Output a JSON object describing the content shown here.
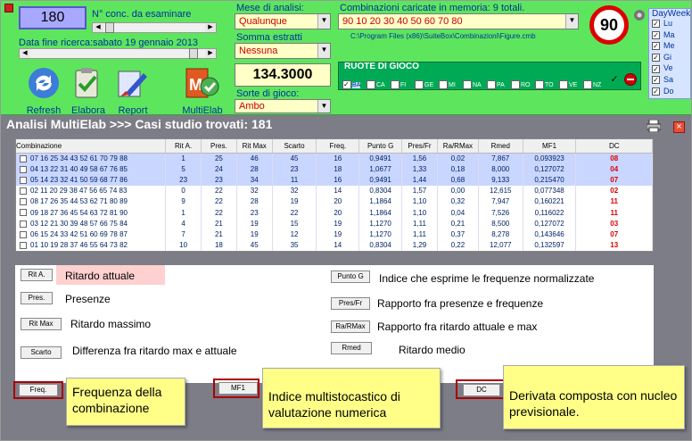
{
  "toolbar": {
    "count_value": "180",
    "count_label": "N° conc. da esaminare",
    "date_label": "Data fine ricerca:",
    "date_value": "sabato 19 gennaio 2013",
    "refresh": "Refresh",
    "elabora": "Elabora",
    "report": "Report",
    "multielab": "MultiElab",
    "mese_label": "Mese di analisi:",
    "mese_value": "Qualunque",
    "somma_label": "Somma estratti",
    "somma_value": "Nessuna",
    "number_value": "134.3000",
    "sorte_label": "Sorte di gioco:",
    "sorte_value": "Ambo",
    "combo_label": "Combinazioni caricate in memoria: 9 totali.",
    "combo_value": "90 10 20 30 40 50 60 70 80",
    "path": "C:\\Program Files (x86)\\SuiteBox\\Combinazioni\\Figure.cmb",
    "ruote_label": "RUOTE DI GIOCO",
    "ruote": [
      "BA",
      "CA",
      "FI",
      "GE",
      "MI",
      "NA",
      "PA",
      "RO",
      "TO",
      "VE",
      "NZ"
    ],
    "logo_90": "90",
    "dayweek_label": "DayWeek",
    "days": [
      "Lu",
      "Ma",
      "Me",
      "Gi",
      "Ve",
      "Sa",
      "Do"
    ]
  },
  "main": {
    "title": "Analisi MultiElab >>> Casi studio trovati: 181",
    "columns": [
      "Combinazione",
      "Rit A.",
      "Pres.",
      "Rit Max",
      "Scarto",
      "Freq.",
      "Punto G",
      "Pres/Fr",
      "Ra/RMax",
      "Rmed",
      "MF1",
      "DC"
    ],
    "rows": [
      [
        "07 16 25 34 43 52 61 70 79 88",
        "1",
        "25",
        "46",
        "45",
        "16",
        "0,9491",
        "1,56",
        "0,02",
        "7,867",
        "0,093923",
        "08"
      ],
      [
        "04 13 22 31 40 49 58 67 76 85",
        "5",
        "24",
        "28",
        "23",
        "18",
        "1,0677",
        "1,33",
        "0,18",
        "8,000",
        "0,127072",
        "04"
      ],
      [
        "05 14 23 32 41 50 59 68 77 86",
        "23",
        "23",
        "34",
        "11",
        "16",
        "0,9491",
        "1,44",
        "0,68",
        "9,133",
        "0,215470",
        "07"
      ],
      [
        "02 11 20 29 38 47 56 65 74 83",
        "0",
        "22",
        "32",
        "32",
        "14",
        "0,8304",
        "1,57",
        "0,00",
        "12,615",
        "0,077348",
        "02"
      ],
      [
        "08 17 26 35 44 53 62 71 80 89",
        "9",
        "22",
        "28",
        "19",
        "20",
        "1,1864",
        "1,10",
        "0,32",
        "7,947",
        "0,160221",
        "11"
      ],
      [
        "09 18 27 36 45 54 63 72 81 90",
        "1",
        "22",
        "23",
        "22",
        "20",
        "1,1864",
        "1,10",
        "0,04",
        "7,526",
        "0,116022",
        "11"
      ],
      [
        "03 12 21 30 39 48 57 66 75 84",
        "4",
        "21",
        "19",
        "15",
        "19",
        "1,1270",
        "1,11",
        "0,21",
        "8,500",
        "0,127072",
        "03"
      ],
      [
        "06 15 24 33 42 51 60 69 78 87",
        "7",
        "21",
        "19",
        "12",
        "19",
        "1,1270",
        "1,11",
        "0,37",
        "8,278",
        "0,143646",
        "07"
      ],
      [
        "01 10 19 28 37 46 55 64 73 82",
        "10",
        "18",
        "45",
        "35",
        "14",
        "0,8304",
        "1,29",
        "0,22",
        "12,077",
        "0,132597",
        "13"
      ]
    ]
  },
  "legend": {
    "rita_btn": "Rit A.",
    "rita_txt": "Ritardo attuale",
    "pres_btn": "Pres.",
    "pres_txt": "Presenze",
    "ritmax_btn": "Rit Max",
    "ritmax_txt": "Ritardo massimo",
    "scarto_btn": "Scarto",
    "scarto_txt": "Differenza fra ritardo max e attuale",
    "puntog_btn": "Punto G",
    "puntog_txt": "Indice che esprime le frequenze normalizzate",
    "presfr_btn": "Pres/Fr",
    "presfr_txt": "Rapporto fra presenze e frequenze",
    "rarmax_btn": "Ra/RMax",
    "rarmax_txt": "Rapporto fra ritardo attuale e max",
    "rmed_btn": "Rmed",
    "rmed_txt": "Ritardo medio"
  },
  "bottom": {
    "freq_btn": "Freq.",
    "freq_txt": "Frequenza della combinazione",
    "mf1_btn": "MF1",
    "mf1_txt": "Indice multistocastico di valutazione numerica",
    "dc_btn": "DC",
    "dc_txt": "Derivata composta con nucleo previsionale."
  }
}
